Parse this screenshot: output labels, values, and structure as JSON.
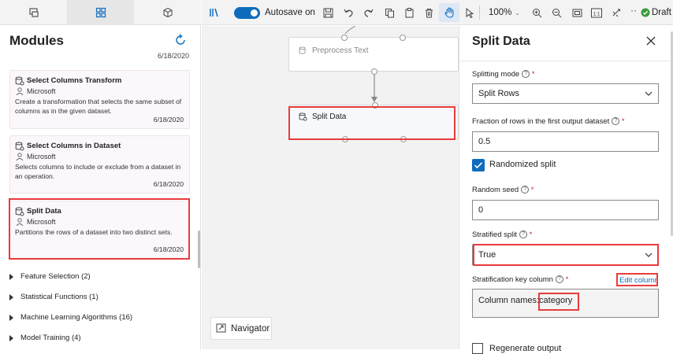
{
  "left_panel": {
    "title": "Modules",
    "top_date": "6/18/2020",
    "cards": [
      {
        "title": "Select Columns Transform",
        "publisher": "Microsoft",
        "description": "Create a transformation that selects the same subset of columns as in the given dataset.",
        "date": "6/18/2020"
      },
      {
        "title": "Select Columns in Dataset",
        "publisher": "Microsoft",
        "description": "Selects columns to include or exclude from a dataset in an operation.",
        "date": "6/18/2020"
      },
      {
        "title": "Split Data",
        "publisher": "Microsoft",
        "description": "Partitions the rows of a dataset into two distinct sets.",
        "date": "6/18/2020"
      }
    ],
    "categories": [
      {
        "label": "Feature Selection (2)"
      },
      {
        "label": "Statistical Functions (1)"
      },
      {
        "label": "Machine Learning Algorithms (16)"
      },
      {
        "label": "Model Training (4)"
      }
    ]
  },
  "toolbar": {
    "autosave_label": "Autosave on",
    "zoom": "100%",
    "status": "Draft"
  },
  "canvas": {
    "nodes": [
      {
        "title": "Preprocess Text"
      },
      {
        "title": "Split Data"
      }
    ],
    "navigator_label": "Navigator"
  },
  "right_panel": {
    "title": "Split Data",
    "splitting_mode_label": "Splitting mode",
    "splitting_mode_value": "Split Rows",
    "fraction_label": "Fraction of rows in the first output dataset",
    "fraction_value": "0.5",
    "randomized_label": "Randomized split",
    "random_seed_label": "Random seed",
    "random_seed_value": "0",
    "stratified_label": "Stratified split",
    "stratified_value": "True",
    "strat_key_label": "Stratification key column",
    "edit_column_link": "Edit column",
    "column_names_label": "Column names:",
    "column_names_value": "category",
    "regenerate_label": "Regenerate output"
  },
  "colors": {
    "accent": "#0f6cbd",
    "highlight": "#e83b3b",
    "draft_green": "#3a9a3a"
  }
}
